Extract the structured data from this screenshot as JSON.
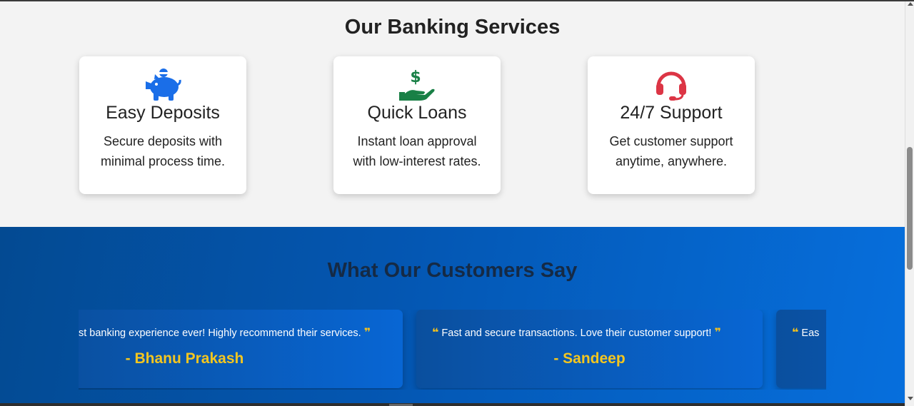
{
  "services": {
    "title": "Our Banking Services",
    "cards": [
      {
        "icon": "piggy-bank-icon",
        "icon_color": "#1a6ee8",
        "title": "Easy Deposits",
        "desc_line1": "Secure deposits with",
        "desc_line2": "minimal process time."
      },
      {
        "icon": "hand-holding-dollar-icon",
        "icon_color": "#198046",
        "title": "Quick Loans",
        "desc_line1": "Instant loan approval",
        "desc_line2": "with low-interest rates."
      },
      {
        "icon": "headset-icon",
        "icon_color": "#dc3545",
        "title": "24/7 Support",
        "desc_line1": "Get customer support",
        "desc_line2": "anytime, anywhere."
      }
    ]
  },
  "testimonials": {
    "title": "What Our Customers Say",
    "items": [
      {
        "quote": "st banking experience ever! Highly recommend their services.",
        "name": "- Bhanu Prakash"
      },
      {
        "quote": "Fast and secure transactions. Love their customer support!",
        "name": "- Sandeep"
      },
      {
        "quote": "Eas",
        "name": ""
      }
    ],
    "open_quote": "❝",
    "close_quote": "❞",
    "accent_color": "#f4c61f"
  }
}
